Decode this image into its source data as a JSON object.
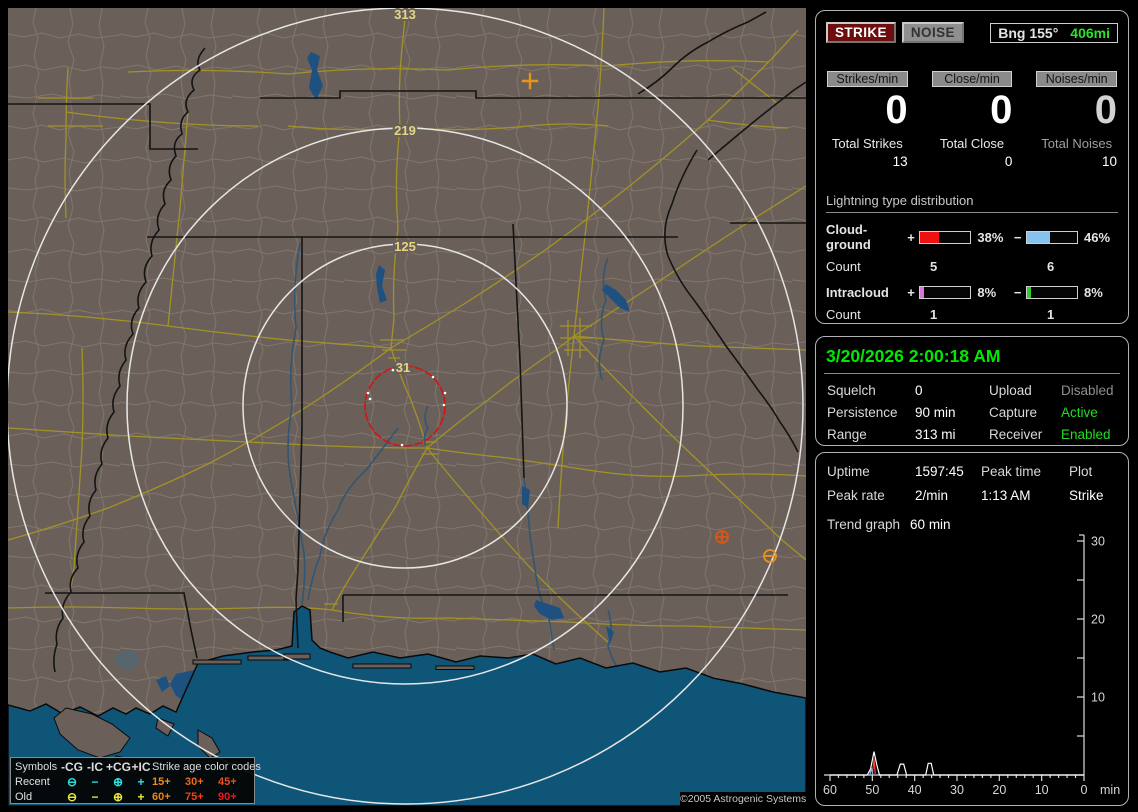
{
  "header": {
    "strike_button": "STRIKE",
    "noise_button": "NOISE",
    "bearing_label": "Bng 155°",
    "bearing_range": "406mi"
  },
  "counters": {
    "columns": [
      {
        "label": "Strikes/min",
        "rate": "0",
        "total_label": "Total Strikes",
        "total": "13"
      },
      {
        "label": "Close/min",
        "rate": "0",
        "total_label": "Total Close",
        "total": "0"
      },
      {
        "label": "Noises/min",
        "rate": "0",
        "total_label": "Total Noises",
        "total": "10"
      }
    ]
  },
  "distribution": {
    "title": "Lightning type distribution",
    "count_label": "Count",
    "rows": [
      {
        "label": "Cloud-ground",
        "plus_sign": "+",
        "minus_sign": "−",
        "plus_pct": 38,
        "plus_pct_label": "38%",
        "plus_color": "#ee1111",
        "plus_count": "5",
        "minus_pct": 46,
        "minus_pct_label": "46%",
        "minus_color": "#85c2ee",
        "minus_count": "6"
      },
      {
        "label": "Intracloud",
        "plus_sign": "+",
        "minus_sign": "−",
        "plus_pct": 8,
        "plus_pct_label": "8%",
        "plus_color": "#da74da",
        "plus_count": "1",
        "minus_pct": 8,
        "minus_pct_label": "8%",
        "minus_color": "#2ecc2e",
        "minus_count": "1"
      }
    ]
  },
  "status": {
    "datetime": "3/20/2026 2:00:18 AM",
    "squelch_label": "Squelch",
    "squelch": "0",
    "persistence_label": "Persistence",
    "persistence": "90 min",
    "range_label": "Range",
    "range": "313 mi",
    "upload_label": "Upload",
    "upload": "Disabled",
    "upload_color": "#8f8f8f",
    "capture_label": "Capture",
    "capture": "Active",
    "capture_color": "#22dd22",
    "receiver_label": "Receiver",
    "receiver": "Enabled",
    "receiver_color": "#22dd22"
  },
  "stats": {
    "uptime_label": "Uptime",
    "uptime": "1597:45",
    "peak_time_label": "Peak time",
    "plot_label": "Plot",
    "peak_rate_label": "Peak rate",
    "peak_rate": "2/min",
    "peak_time": "1:13 AM",
    "plot_mode": "Strike",
    "trend_label": "Trend graph",
    "trend_window": "60 min"
  },
  "chart_data": {
    "type": "line",
    "title": "Trend graph 60 min",
    "x_label": "min",
    "xlim": [
      60,
      0
    ],
    "x_ticks": [
      60,
      50,
      40,
      30,
      20,
      10,
      0
    ],
    "ylim": [
      0,
      30
    ],
    "y_ticks": [
      10,
      20,
      30
    ],
    "y_minor_step": 5,
    "x_minor_step": 2,
    "series": [
      {
        "name": "strike-rate",
        "color": "#ffffff",
        "points": [
          [
            60,
            0
          ],
          [
            51.2,
            0
          ],
          [
            50.4,
            0.8
          ],
          [
            49.6,
            3
          ],
          [
            48.9,
            1.2
          ],
          [
            48.3,
            0
          ],
          [
            44.2,
            0
          ],
          [
            43.4,
            1.4
          ],
          [
            42.6,
            1.4
          ],
          [
            41.9,
            0
          ],
          [
            37.4,
            0
          ],
          [
            36.8,
            1.5
          ],
          [
            36.1,
            1.5
          ],
          [
            35.5,
            0
          ],
          [
            0,
            0
          ]
        ]
      },
      {
        "name": "cg-plus-rate",
        "color": "#ff4040",
        "points": [
          [
            50.0,
            0
          ],
          [
            49.6,
            2.1
          ],
          [
            49.3,
            0
          ]
        ]
      },
      {
        "name": "cg-minus-rate",
        "color": "#7fb7e8",
        "points": [
          [
            50.6,
            0
          ],
          [
            50.2,
            0.9
          ],
          [
            49.9,
            0
          ]
        ]
      }
    ]
  },
  "map": {
    "rings": [
      {
        "label": "31"
      },
      {
        "label": "125"
      },
      {
        "label": "219"
      },
      {
        "label": "313"
      }
    ],
    "markers": [
      {
        "type": "intracloud-positive",
        "symbol": "+",
        "color": "#e8941a"
      },
      {
        "type": "cloudground-positive",
        "symbol": "⊕",
        "color": "#df5512"
      },
      {
        "type": "cloudground-negative",
        "symbol": "⊖",
        "color": "#e8941a"
      }
    ],
    "copyright": "©2005 Astrogenic Systems",
    "legend": {
      "symbols_header": "Symbols",
      "col_cg_neg": "-CG",
      "col_ic_neg": "-IC",
      "col_cg_pos": "+CG",
      "col_ic_pos": "+IC",
      "age_header": "Strike age color codes",
      "recent_label": "Recent",
      "old_label": "Old",
      "recent_color": "#2ee2e2",
      "old_color": "#e8e83c",
      "sym_circle_minus": "⊖",
      "sym_minus": "−",
      "sym_circle_plus": "⊕",
      "sym_plus": "+",
      "ages": [
        {
          "label": "15+",
          "color": "#ef8e1b"
        },
        {
          "label": "30+",
          "color": "#ef6a1f"
        },
        {
          "label": "45+",
          "color": "#ea511d"
        },
        {
          "label": "60+",
          "color": "#e9831a"
        },
        {
          "label": "75+",
          "color": "#ee421c"
        },
        {
          "label": "90+",
          "color": "#f21717"
        }
      ]
    }
  }
}
